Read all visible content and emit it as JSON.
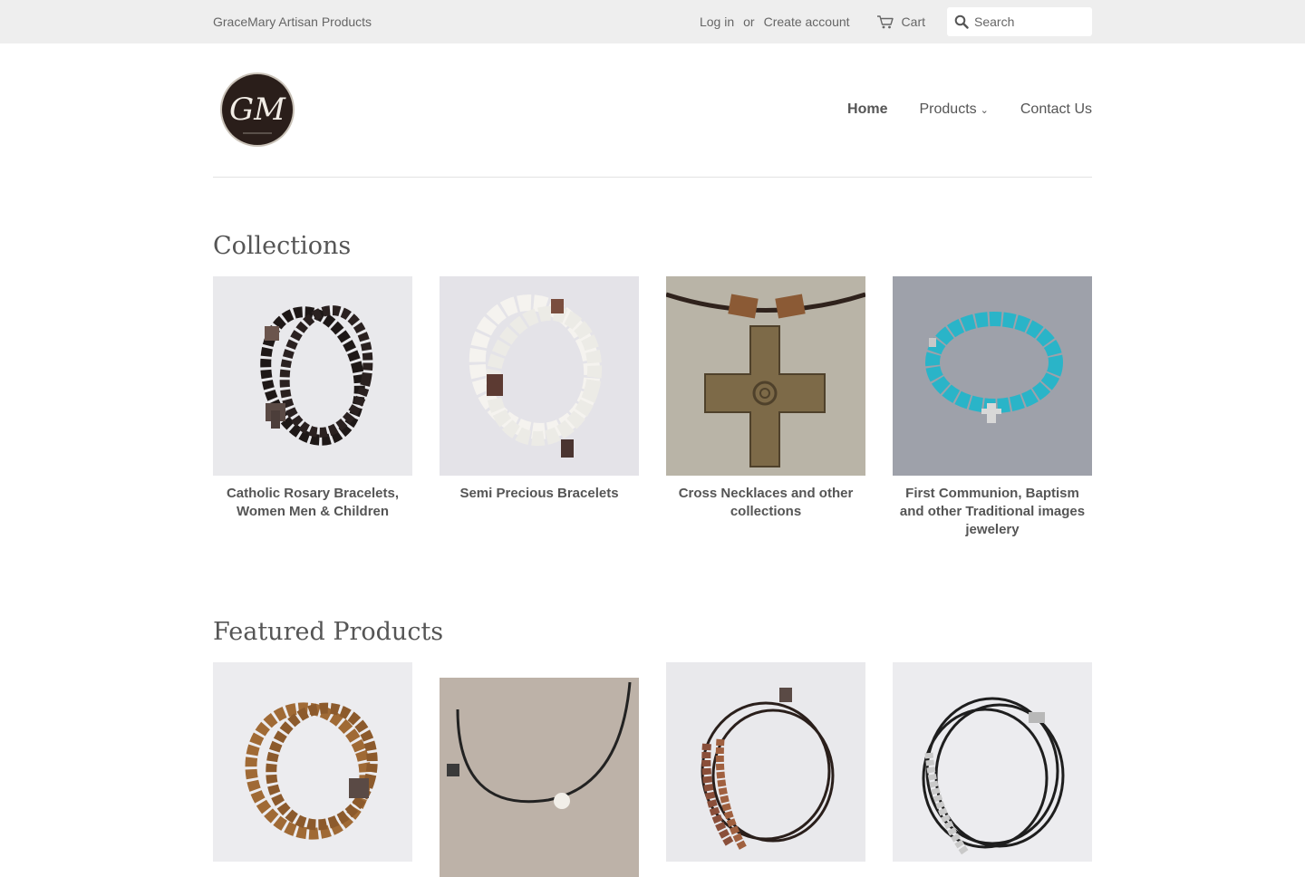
{
  "topbar": {
    "shop_name": "GraceMary Artisan Products",
    "login": "Log in",
    "or": "or",
    "create_account": "Create account",
    "cart": "Cart",
    "search_placeholder": "Search"
  },
  "header": {
    "logo_text": "GM",
    "nav": [
      {
        "label": "Home",
        "active": true
      },
      {
        "label": "Products",
        "has_dropdown": true
      },
      {
        "label": "Contact Us"
      }
    ]
  },
  "collections": {
    "title": "Collections",
    "items": [
      {
        "title": "Catholic Rosary Bracelets, Women Men & Children",
        "image": "dark-bead-rosary-bracelet"
      },
      {
        "title": "Semi Precious Bracelets",
        "image": "white-howlite-bracelet"
      },
      {
        "title": "Cross Necklaces and other collections",
        "image": "bronze-cross-necklace"
      },
      {
        "title": "First Communion, Baptism and other Traditional images jewelery",
        "image": "turquoise-bead-bracelet"
      }
    ]
  },
  "featured": {
    "title": "Featured Products",
    "items": [
      {
        "image": "wood-bead-rosary-wrap"
      },
      {
        "image": "leather-cord-pearl-necklace"
      },
      {
        "image": "copper-bead-leather-bracelet"
      },
      {
        "image": "silver-bead-leather-bracelet"
      }
    ]
  },
  "colors": {
    "topbar_bg": "#eeeeee",
    "text": "#555555",
    "link": "#666666",
    "divider": "#e2e2e2"
  }
}
